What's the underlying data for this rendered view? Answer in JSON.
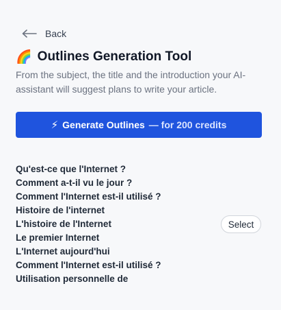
{
  "nav": {
    "back_label": "Back"
  },
  "header": {
    "icon_emoji": "🌈",
    "title": "Outlines Generation Tool",
    "description": "From the subject, the title and the introduction your AI-assistant will suggest plans to write your article."
  },
  "generate_button": {
    "icon": "⚡",
    "label": "Generate Outlines",
    "credits_label": "— for 200 credits"
  },
  "outline": {
    "items": [
      "Qu'est-ce que l'Internet ?",
      "Comment a-t-il vu le jour ?",
      "Comment l'Internet est-il utilisé ?",
      "Histoire de l'internet",
      "L'histoire de l'Internet",
      "Le premier Internet",
      "L'Internet aujourd'hui",
      "Comment l'Internet est-il utilisé ?",
      "Utilisation personnelle de"
    ],
    "select_label": "Select"
  },
  "colors": {
    "primary": "#1f54de",
    "background": "#f7f8fa"
  }
}
